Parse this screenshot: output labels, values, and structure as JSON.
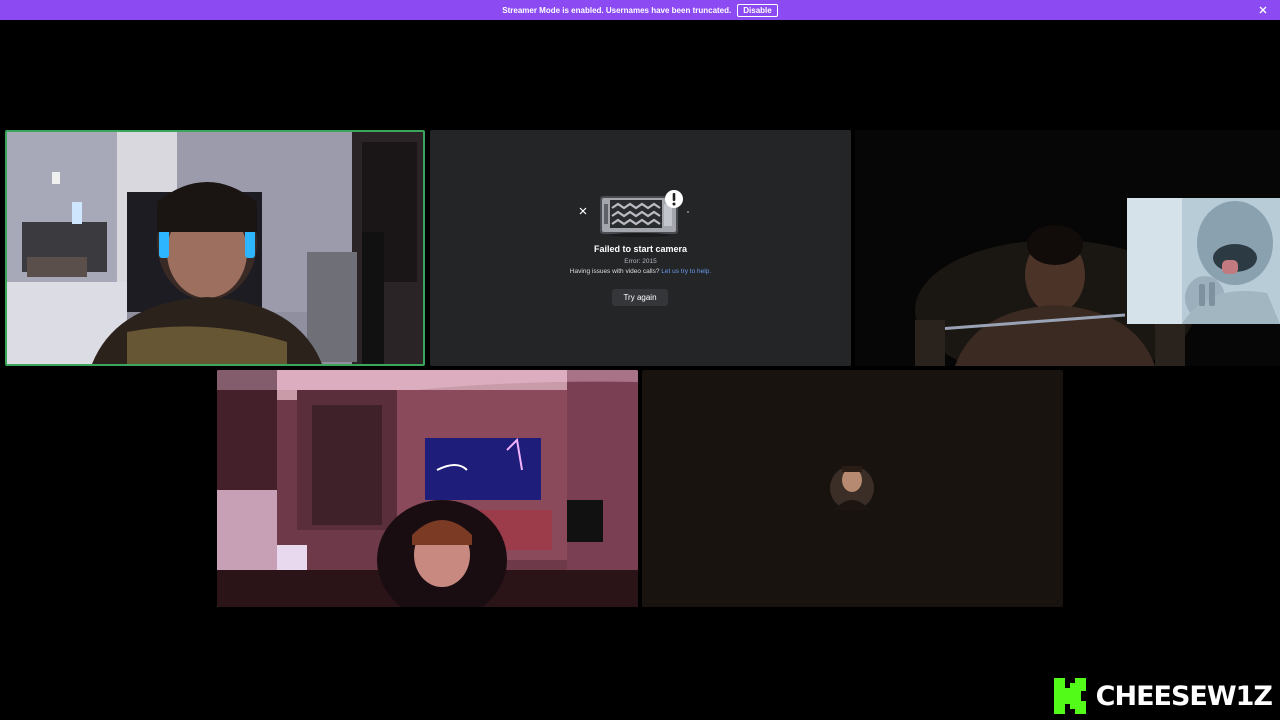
{
  "banner": {
    "message": "Streamer Mode is enabled. Usernames have been truncated.",
    "disable_label": "Disable",
    "color": "#8c4bf2"
  },
  "tiles": [
    {
      "kind": "video",
      "speaking": true,
      "speaking_color": "#3ba55c"
    },
    {
      "kind": "camera-error"
    },
    {
      "kind": "video",
      "has_pip": true
    },
    {
      "kind": "video"
    },
    {
      "kind": "avatar"
    }
  ],
  "camera_error": {
    "title": "Failed to start camera",
    "error_code": "Error: 2015",
    "help_prefix": "Having issues with video calls?",
    "help_link": "Let us try to help.",
    "try_again_label": "Try again",
    "link_color": "#6b9cf0"
  },
  "watermark": {
    "text": "CHEESEW1Z",
    "logo_letter": "K",
    "logo_color": "#53fc18"
  },
  "icons": {
    "close": "close-icon",
    "warning": "exclamation-icon"
  }
}
